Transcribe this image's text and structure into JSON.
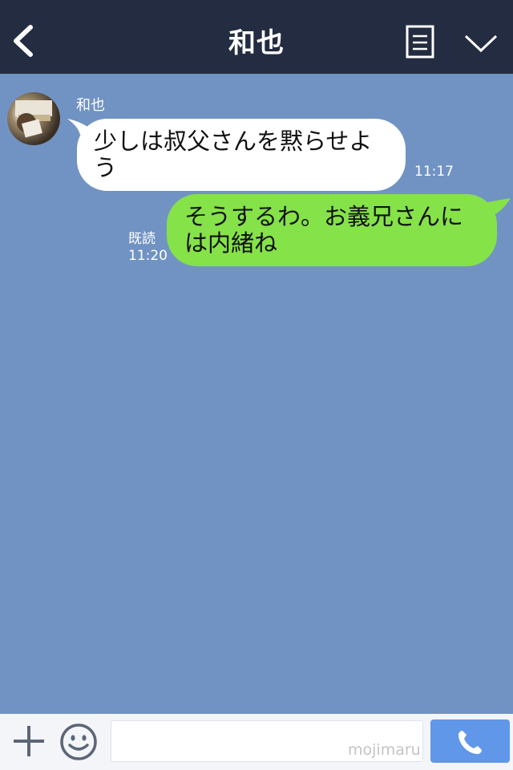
{
  "header": {
    "title": "和也",
    "back_icon": "chevron-left-icon",
    "memo_icon": "document-list-icon",
    "menu_icon": "chevron-down-icon"
  },
  "chat": {
    "incoming": {
      "sender": "和也",
      "avatar_icon": "avatar-photo",
      "text": "少しは叔父さんを黙らせよう",
      "time": "11:17"
    },
    "outgoing": {
      "text": "そうするわ。お義兄さんには内緒ね",
      "read_label": "既読",
      "time": "11:20"
    }
  },
  "footer": {
    "plus_icon": "plus-icon",
    "emoji_icon": "smiley-icon",
    "input_value": "",
    "watermark": "mojimaru",
    "call_icon": "phone-icon"
  },
  "colors": {
    "header_bg": "#232c40",
    "chat_bg": "#7193c3",
    "incoming_bubble": "#ffffff",
    "outgoing_bubble": "#85e249",
    "call_button": "#6097e9"
  }
}
